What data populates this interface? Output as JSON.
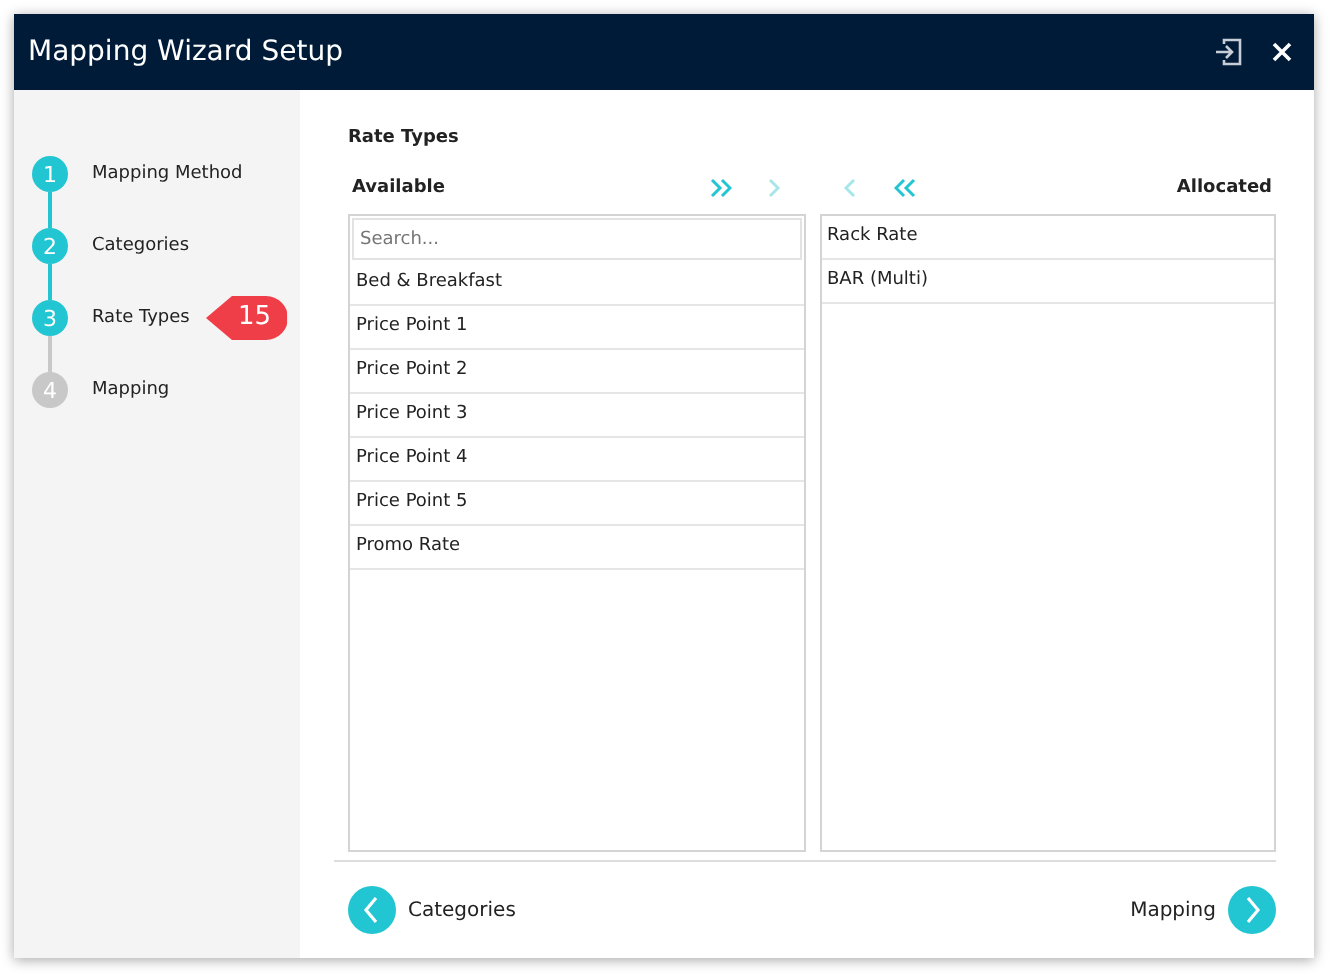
{
  "window": {
    "title": "Mapping Wizard Setup"
  },
  "steps": [
    {
      "number": "1",
      "label": "Mapping Method",
      "completed": true
    },
    {
      "number": "2",
      "label": "Categories",
      "completed": true
    },
    {
      "number": "3",
      "label": "Rate Types",
      "completed": true,
      "annotation": "15"
    },
    {
      "number": "4",
      "label": "Mapping",
      "completed": false
    }
  ],
  "section_title": "Rate Types",
  "available": {
    "heading": "Available",
    "search_placeholder": "Search...",
    "items": [
      "Bed & Breakfast",
      "Price Point 1",
      "Price Point 2",
      "Price Point 3",
      "Price Point 4",
      "Price Point 5",
      "Promo Rate"
    ]
  },
  "transfer_buttons": [
    {
      "kind": "add-all",
      "disabled": false
    },
    {
      "kind": "add-one",
      "disabled": true
    },
    {
      "kind": "remove-one",
      "disabled": true
    },
    {
      "kind": "remove-all",
      "disabled": false
    }
  ],
  "allocated": {
    "heading": "Allocated",
    "items": [
      "Rack Rate",
      "BAR (Multi)"
    ]
  },
  "footer": {
    "back": "Categories",
    "next": "Mapping"
  }
}
